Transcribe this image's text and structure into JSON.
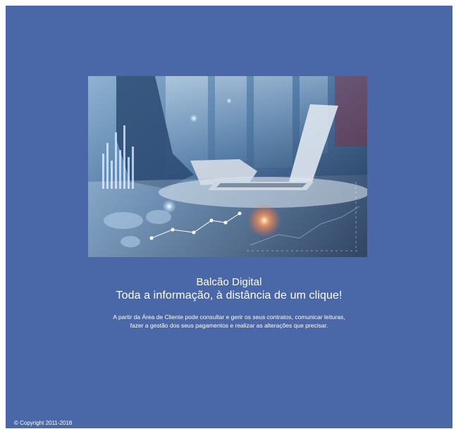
{
  "page": {
    "app_name": "Balcão Digital",
    "tagline": "Toda a informação, à distância de um clique!",
    "description_line1": "A partir da Área de Cliente pode consultar e gerir os seus contratos, comunicar leituras,",
    "description_line2": "fazer a gestão dos seus pagamentos e realizar as alterações que precisar.",
    "copyright": "© Copyright 2011-2018"
  },
  "colors": {
    "background": "#4a67a8",
    "text": "#ffffff"
  }
}
